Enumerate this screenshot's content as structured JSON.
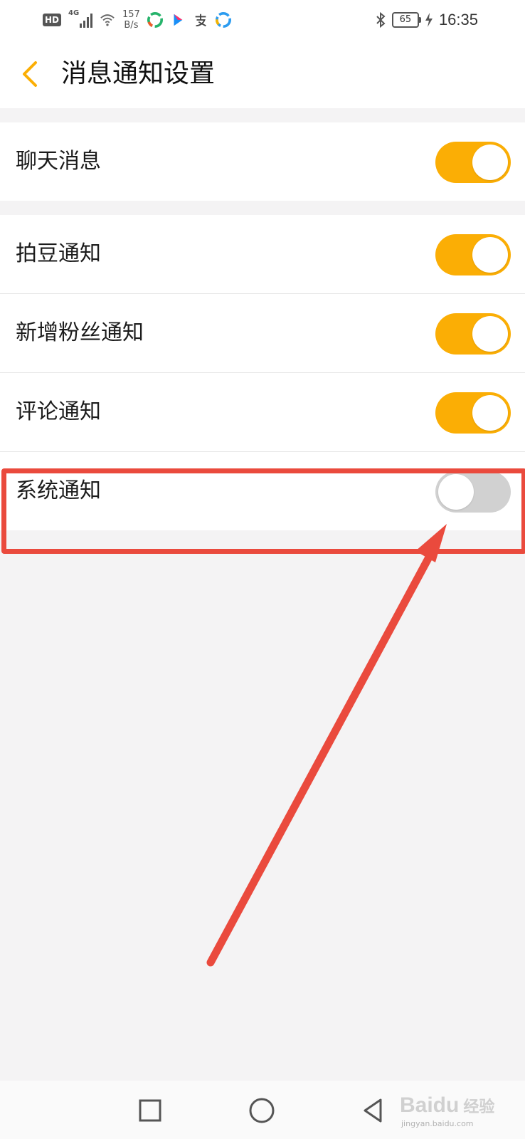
{
  "status_bar": {
    "hd_badge": "HD",
    "network_type": "4G",
    "speed_value": "157",
    "speed_unit": "B/s",
    "battery": "65",
    "time": "16:35",
    "icons": [
      "hd-icon",
      "signal-icon",
      "wifi-icon",
      "app-icon",
      "youku-icon",
      "alipay-icon",
      "app-icon",
      "bluetooth-icon",
      "battery-icon",
      "charging-icon"
    ]
  },
  "header": {
    "back_icon": "chevron-left-icon",
    "title": "消息通知设置"
  },
  "settings": {
    "chat": {
      "label": "聊天消息",
      "enabled": true
    },
    "paidou": {
      "label": "拍豆通知",
      "enabled": true
    },
    "new_fans": {
      "label": "新增粉丝通知",
      "enabled": true
    },
    "comments": {
      "label": "评论通知",
      "enabled": true
    },
    "system": {
      "label": "系统通知",
      "enabled": false
    }
  },
  "colors": {
    "accent": "#fbae05",
    "toggle_off": "#d1d1d1",
    "annotation": "#ea4a3d",
    "background": "#f4f3f4"
  },
  "watermark": {
    "brand": "Baidu",
    "brand_suffix": "经验",
    "url": "jingyan.baidu.com"
  },
  "nav_bar": {
    "icons": [
      "recent-apps-icon",
      "home-icon",
      "back-icon"
    ]
  }
}
